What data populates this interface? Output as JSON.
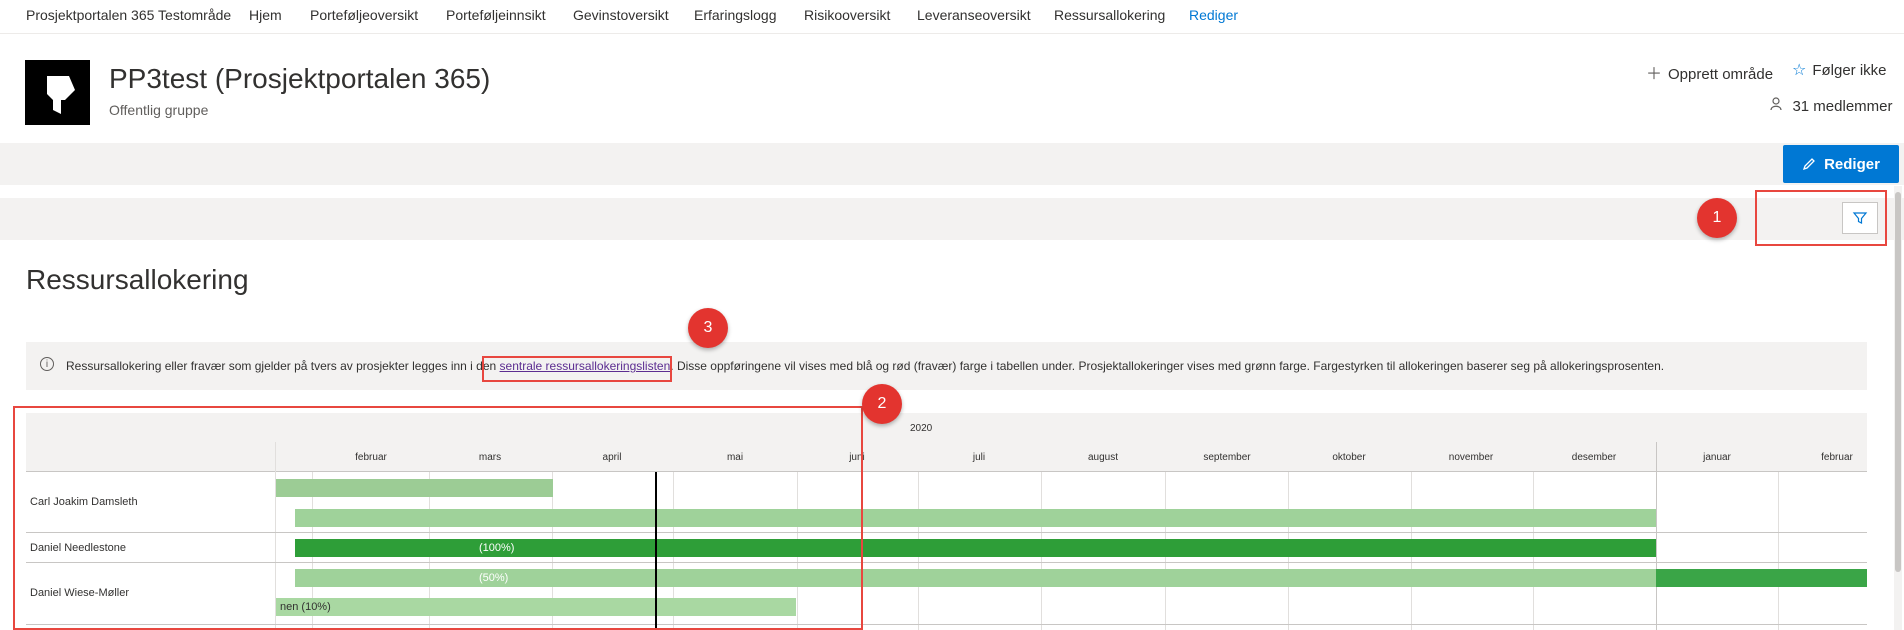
{
  "topnav": {
    "site": "Prosjektportalen 365 Testområde",
    "items": [
      "Hjem",
      "Porteføljeoversikt",
      "Porteføljeinnsikt",
      "Gevinstoversikt",
      "Erfaringslogg",
      "Risikooversikt",
      "Leveranseoversikt",
      "Ressursallokering",
      "Rediger"
    ]
  },
  "header": {
    "title": "PP3test (Prosjektportalen 365)",
    "subtitle": "Offentlig gruppe",
    "create_area": "Opprett område",
    "follow": "Følger ikke",
    "members": "31 medlemmer"
  },
  "command": {
    "edit": "Rediger"
  },
  "badges": [
    "1",
    "2",
    "3"
  ],
  "section": {
    "title": "Ressursallokering",
    "info_before": "Ressursallokering eller fravær som gjelder på tvers av prosjekter legges inn i den ",
    "info_link": "sentrale ressursallokeringslisten",
    "info_after": ". Disse oppføringene vil vises med blå og rød (fravær) farge i tabellen under. Prosjektallokeringer vises med grønn farge. Fargestyrken til allokeringen baserer seg på allokeringsprosenten."
  },
  "timeline": {
    "year": "2020",
    "months": [
      "februar",
      "mars",
      "april",
      "mai",
      "juni",
      "juli",
      "august",
      "september",
      "oktober",
      "november",
      "desember",
      "januar",
      "februar"
    ],
    "rows": [
      {
        "name": "Carl Joakim Damsleth"
      },
      {
        "name": "Daniel Needlestone"
      },
      {
        "name": "Daniel Wiese-Møller"
      }
    ],
    "bars": {
      "needlestone": "(100%)",
      "wiese_a": "(50%)",
      "wiese_b": "nen (10%)"
    }
  },
  "colors": {
    "accent": "#0078d4",
    "callout": "#e8473f",
    "alloc_dark": "#2e9e38",
    "alloc_light": "#9fd29a"
  }
}
